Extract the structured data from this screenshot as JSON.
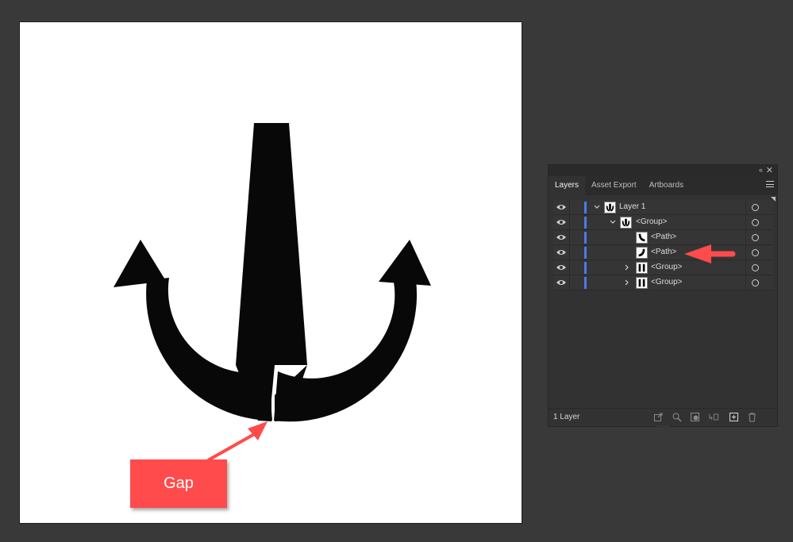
{
  "annotation": {
    "label": "Gap",
    "color": "#ff4b4b"
  },
  "panel": {
    "tabs": [
      "Layers",
      "Asset Export",
      "Artboards"
    ],
    "active_tab": "Layers",
    "layer_color": "#4b7bec",
    "rows": [
      {
        "name": "Layer 1",
        "expander": "expanded",
        "thumbnail": "anchor-full"
      },
      {
        "name": "<Group>",
        "expander": "expanded",
        "thumbnail": "anchor-full"
      },
      {
        "name": "<Path>",
        "expander": "none",
        "thumbnail": "left-arm"
      },
      {
        "name": "<Path>",
        "expander": "none",
        "thumbnail": "right-arm"
      },
      {
        "name": "<Group>",
        "expander": "collapsed",
        "thumbnail": "shank-pair"
      },
      {
        "name": "<Group>",
        "expander": "collapsed",
        "thumbnail": "shank-pair"
      }
    ],
    "footer": {
      "layer_count": "1 Layer",
      "icons": [
        "export-icon",
        "locate-object-icon",
        "make-clipping-mask-icon",
        "create-sublayer-icon",
        "new-layer-icon",
        "trash-icon"
      ]
    }
  }
}
